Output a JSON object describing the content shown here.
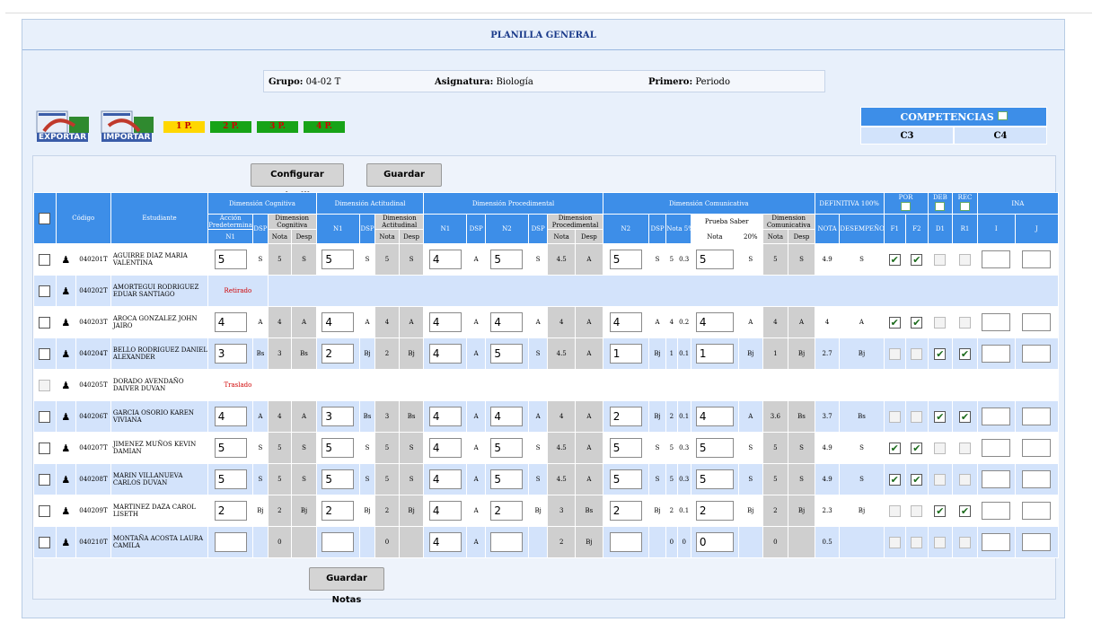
{
  "title": "PLANILLA GENERAL",
  "info": {
    "grupo_label": "Grupo:",
    "grupo_value": "04-02 T",
    "asig_label": "Asignatura:",
    "asig_value": "Biología",
    "per_label": "Primero:",
    "per_value": "Periodo"
  },
  "icons": {
    "export_label": "EXPORTAR",
    "import_label": "IMPORTAR"
  },
  "periods": [
    {
      "label": "1 P.",
      "color": "#ffd700",
      "text": "#c00000"
    },
    {
      "label": "2 P.",
      "color": "#17a317",
      "text": "#d00000"
    },
    {
      "label": "3 P.",
      "color": "#17a317",
      "text": "#d00000"
    },
    {
      "label": "4 P.",
      "color": "#17a317",
      "text": "#d00000"
    }
  ],
  "competencias": {
    "label": "COMPETENCIAS",
    "items": [
      "C3",
      "C4"
    ]
  },
  "buttons": {
    "configurar": "Configurar Planilla",
    "guardar": "Guardar Notas",
    "guardar_bottom": "Guardar Notas"
  },
  "header": {
    "codigo": "Código",
    "estudiante": "Estudiante",
    "cognitiva": "Dimensión Cognitiva",
    "actitudinal": "Dimensión Actitudinal",
    "procedimental": "Dimensión Procedimental",
    "comunicativa": "Dimensión Comunicativa",
    "definitiva": "DEFINITIVA 100%",
    "por": "POR",
    "deb": "DEB",
    "rec": "REC",
    "ina": "INA",
    "accion": "Acción Predeterminada",
    "dim_cog": "Dimension Cognitiva",
    "dim_act": "Dimension Actitudinal",
    "dim_proc": "Dimension Procedimental",
    "prueba": "Prueba Saber",
    "dim_com": "Dimension Comunicativa",
    "n1": "N1",
    "dsp": "DSP",
    "nota": "Nota",
    "desp": "Desp",
    "n2": "N2",
    "nota5": "Nota 5%",
    "pct20": "20%",
    "nota_def": "NOTA",
    "desempeno": "DESEMPEÑO",
    "f1": "F1",
    "f2": "F2",
    "d1": "D1",
    "r1": "R1",
    "i": "I",
    "j": "J"
  },
  "students": [
    {
      "code": "040201T",
      "name": "AGUIRRE DIAZ MARIA VALENTINA",
      "status": "",
      "cog_n1": "5",
      "cog_dsp": "S",
      "cog_nota": "5",
      "cog_desp": "S",
      "act_n1": "5",
      "act_dsp": "S",
      "act_nota": "5",
      "act_desp": "S",
      "proc_n1": "4",
      "proc_dsp1": "A",
      "proc_n2": "5",
      "proc_dsp2": "S",
      "proc_nota": "4.5",
      "proc_desp": "A",
      "com_n2": "5",
      "com_dsp": "S",
      "com_nota": "5",
      "com_5": "0.3",
      "ps_nota": "5",
      "ps_20": "S",
      "com_dnota": "5",
      "com_ddesp": "S",
      "def_nota": "4.9",
      "def_desp": "S",
      "f1": true,
      "f2": true,
      "d1": false,
      "r1": false,
      "act": true,
      "checkDis": true
    },
    {
      "code": "040202T",
      "name": "AMORTEGUI RODRIGUEZ EDUAR SANTIAGO",
      "status": "Retirado"
    },
    {
      "code": "040203T",
      "name": "AROCA GONZALEZ JOHN JAIRO",
      "status": "",
      "cog_n1": "4",
      "cog_dsp": "A",
      "cog_nota": "4",
      "cog_desp": "A",
      "act_n1": "4",
      "act_dsp": "A",
      "act_nota": "4",
      "act_desp": "A",
      "proc_n1": "4",
      "proc_dsp1": "A",
      "proc_n2": "4",
      "proc_dsp2": "A",
      "proc_nota": "4",
      "proc_desp": "A",
      "com_n2": "4",
      "com_dsp": "A",
      "com_nota": "4",
      "com_5": "0.2",
      "ps_nota": "4",
      "ps_20": "A",
      "com_dnota": "4",
      "com_ddesp": "A",
      "def_nota": "4",
      "def_desp": "A",
      "f1": true,
      "f2": true,
      "d1": false,
      "r1": false,
      "checkDis": true
    },
    {
      "code": "040204T",
      "name": "BELLO RODRIGUEZ DANIEL ALEXANDER",
      "status": "",
      "cog_n1": "3",
      "cog_dsp": "Bs",
      "cog_nota": "3",
      "cog_desp": "Bs",
      "act_n1": "2",
      "act_dsp": "Bj",
      "act_nota": "2",
      "act_desp": "Bj",
      "proc_n1": "4",
      "proc_dsp1": "A",
      "proc_n2": "5",
      "proc_dsp2": "S",
      "proc_nota": "4.5",
      "proc_desp": "A",
      "com_n2": "1",
      "com_dsp": "Bj",
      "com_nota": "1",
      "com_5": "0.1",
      "ps_nota": "1",
      "ps_20": "Bj",
      "com_dnota": "1",
      "com_ddesp": "Bj",
      "def_nota": "2.7",
      "def_desp": "Bj",
      "f1": false,
      "f2": false,
      "d1": true,
      "r1": true,
      "checkDis": true
    },
    {
      "code": "040205T",
      "name": "DORADO AVENDAÑO DAIVER DUVAN",
      "status": "Traslado"
    },
    {
      "code": "040206T",
      "name": "GARCIA OSORIO KAREN VIVIANA",
      "status": "",
      "cog_n1": "4",
      "cog_dsp": "A",
      "cog_nota": "4",
      "cog_desp": "A",
      "act_n1": "3",
      "act_dsp": "Bs",
      "act_nota": "3",
      "act_desp": "Bs",
      "proc_n1": "4",
      "proc_dsp1": "A",
      "proc_n2": "4",
      "proc_dsp2": "A",
      "proc_nota": "4",
      "proc_desp": "A",
      "com_n2": "2",
      "com_dsp": "Bj",
      "com_nota": "2",
      "com_5": "0.1",
      "ps_nota": "4",
      "ps_20": "A",
      "com_dnota": "3.6",
      "com_ddesp": "Bs",
      "def_nota": "3.7",
      "def_desp": "Bs",
      "f1": false,
      "f2": false,
      "d1": true,
      "r1": true,
      "checkDis": true
    },
    {
      "code": "040207T",
      "name": "JIMENEZ MUÑOS KEVIN DAMIAN",
      "status": "",
      "cog_n1": "5",
      "cog_dsp": "S",
      "cog_nota": "5",
      "cog_desp": "S",
      "act_n1": "5",
      "act_dsp": "S",
      "act_nota": "5",
      "act_desp": "S",
      "proc_n1": "4",
      "proc_dsp1": "A",
      "proc_n2": "5",
      "proc_dsp2": "S",
      "proc_nota": "4.5",
      "proc_desp": "A",
      "com_n2": "5",
      "com_dsp": "S",
      "com_nota": "5",
      "com_5": "0.3",
      "ps_nota": "5",
      "ps_20": "S",
      "com_dnota": "5",
      "com_ddesp": "S",
      "def_nota": "4.9",
      "def_desp": "S",
      "f1": true,
      "f2": true,
      "d1": false,
      "r1": false,
      "checkDis": true
    },
    {
      "code": "040208T",
      "name": "MARIN VILLANUEVA CARLOS DUVAN",
      "status": "",
      "cog_n1": "5",
      "cog_dsp": "S",
      "cog_nota": "5",
      "cog_desp": "S",
      "act_n1": "5",
      "act_dsp": "S",
      "act_nota": "5",
      "act_desp": "S",
      "proc_n1": "4",
      "proc_dsp1": "A",
      "proc_n2": "5",
      "proc_dsp2": "S",
      "proc_nota": "4.5",
      "proc_desp": "A",
      "com_n2": "5",
      "com_dsp": "S",
      "com_nota": "5",
      "com_5": "0.3",
      "ps_nota": "5",
      "ps_20": "S",
      "com_dnota": "5",
      "com_ddesp": "S",
      "def_nota": "4.9",
      "def_desp": "S",
      "f1": true,
      "f2": true,
      "d1": false,
      "r1": false,
      "checkDis": true
    },
    {
      "code": "040209T",
      "name": "MARTINEZ DAZA CAROL LISETH",
      "status": "",
      "cog_n1": "2",
      "cog_dsp": "Bj",
      "cog_nota": "2",
      "cog_desp": "Bj",
      "act_n1": "2",
      "act_dsp": "Bj",
      "act_nota": "2",
      "act_desp": "Bj",
      "proc_n1": "4",
      "proc_dsp1": "A",
      "proc_n2": "2",
      "proc_dsp2": "Bj",
      "proc_nota": "3",
      "proc_desp": "Bs",
      "com_n2": "2",
      "com_dsp": "Bj",
      "com_nota": "2",
      "com_5": "0.1",
      "ps_nota": "2",
      "ps_20": "Bj",
      "com_dnota": "2",
      "com_ddesp": "Bj",
      "def_nota": "2.3",
      "def_desp": "Bj",
      "f1": false,
      "f2": false,
      "d1": true,
      "r1": true,
      "checkDis": true
    },
    {
      "code": "040210T",
      "name": "MONTAÑA ACOSTA LAURA CAMILA",
      "status": "",
      "cog_n1": "",
      "cog_dsp": "",
      "cog_nota": "0",
      "cog_desp": "",
      "act_n1": "",
      "act_dsp": "",
      "act_nota": "0",
      "act_desp": "",
      "proc_n1": "4",
      "proc_dsp1": "A",
      "proc_n2": "",
      "proc_dsp2": "",
      "proc_nota": "2",
      "proc_desp": "Bj",
      "com_n2": "",
      "com_dsp": "",
      "com_nota": "0",
      "com_5": "0",
      "ps_nota": "0",
      "ps_20": "",
      "com_dnota": "0",
      "com_ddesp": "",
      "def_nota": "0.5",
      "def_desp": "",
      "f1": false,
      "f2": false,
      "d1": false,
      "r1": false,
      "checkDis": true
    }
  ]
}
